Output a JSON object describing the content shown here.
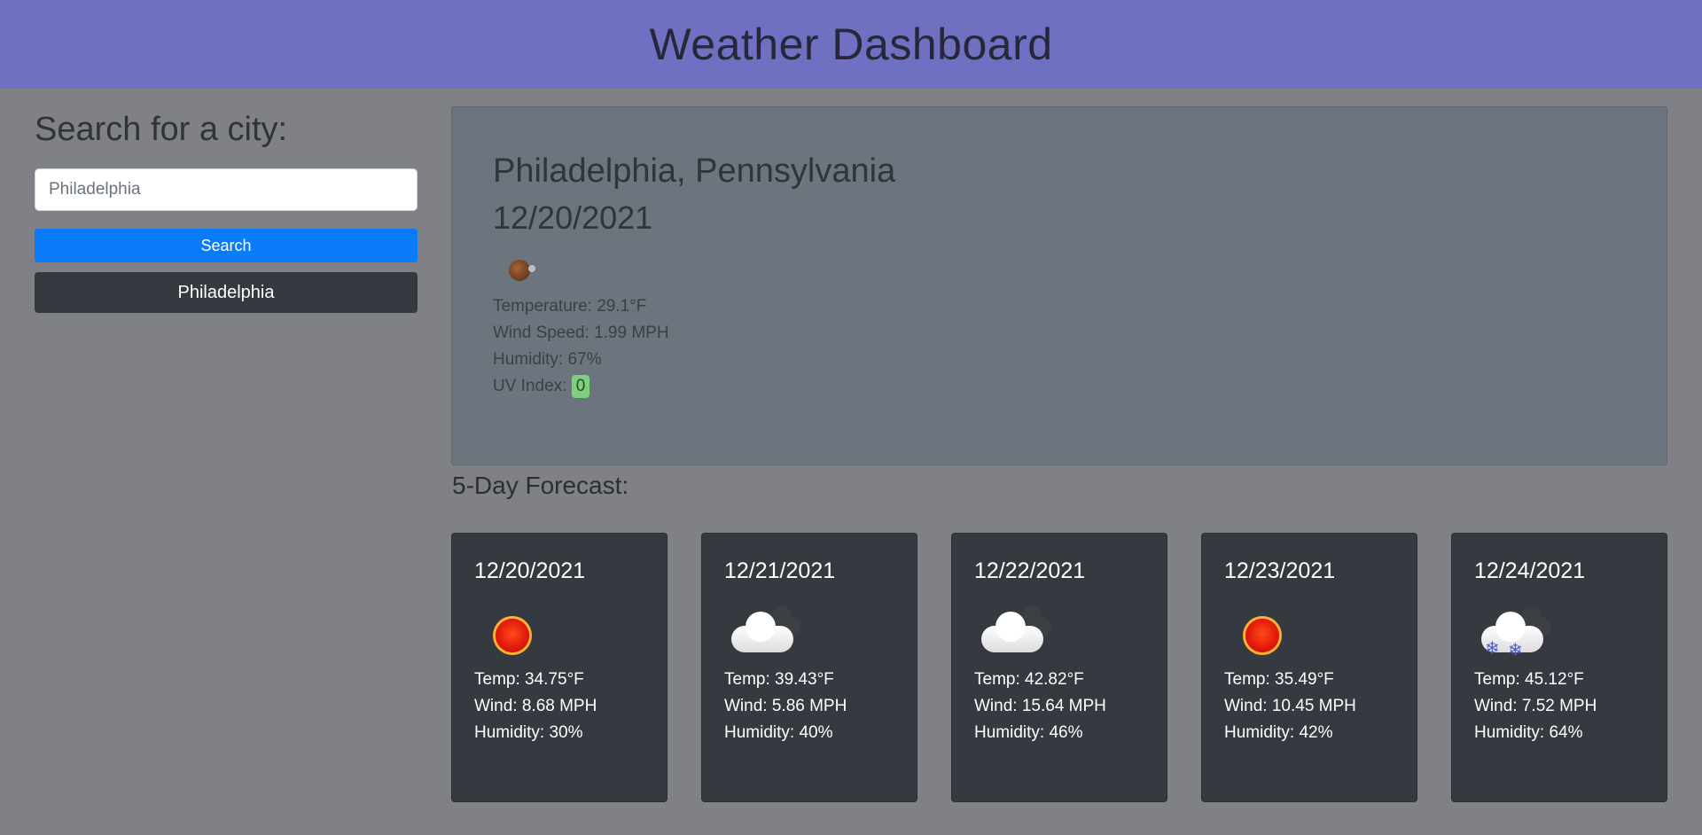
{
  "header": {
    "title": "Weather Dashboard"
  },
  "sidebar": {
    "heading": "Search for a city:",
    "search_value": "Philadelphia",
    "search_button": "Search",
    "history": [
      "Philadelphia"
    ]
  },
  "current": {
    "city": "Philadelphia, Pennsylvania",
    "date": "12/20/2021",
    "icon": "night-clear-icon",
    "temperature": "Temperature: 29.1°F",
    "wind": "Wind Speed: 1.99 MPH",
    "humidity": "Humidity: 67%",
    "uv_label": "UV Index:",
    "uv_value": "0",
    "uv_color": "#7dd07d"
  },
  "forecast": {
    "title": "5-Day Forecast:",
    "days": [
      {
        "date": "12/20/2021",
        "icon": "sun-icon",
        "temp": "Temp: 34.75°F",
        "wind": "Wind: 8.68 MPH",
        "humidity": "Humidity: 30%"
      },
      {
        "date": "12/21/2021",
        "icon": "cloudy-icon",
        "temp": "Temp: 39.43°F",
        "wind": "Wind: 5.86 MPH",
        "humidity": "Humidity: 40%"
      },
      {
        "date": "12/22/2021",
        "icon": "cloudy-icon",
        "temp": "Temp: 42.82°F",
        "wind": "Wind: 15.64 MPH",
        "humidity": "Humidity: 46%"
      },
      {
        "date": "12/23/2021",
        "icon": "sun-icon",
        "temp": "Temp: 35.49°F",
        "wind": "Wind: 10.45 MPH",
        "humidity": "Humidity: 42%"
      },
      {
        "date": "12/24/2021",
        "icon": "snow-cloud-icon",
        "temp": "Temp: 45.12°F",
        "wind": "Wind: 7.52 MPH",
        "humidity": "Humidity: 64%"
      }
    ]
  },
  "colors": {
    "header_bg": "#7070c3",
    "page_bg": "#808087",
    "search_button": "#0a7cf9",
    "card_bg": "#343a40",
    "current_bg": "#6c747d"
  }
}
